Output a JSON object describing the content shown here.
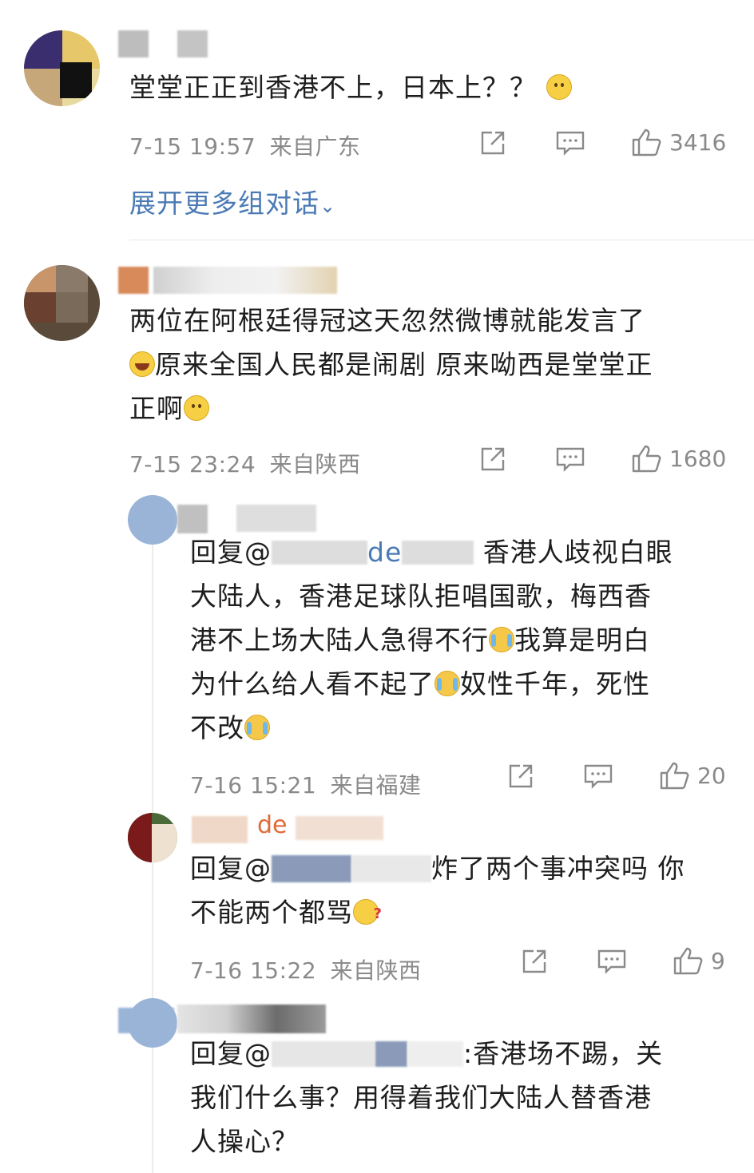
{
  "comments": [
    {
      "text": "堂堂正正到香港不上，日本上？？",
      "time": "7-15 19:57",
      "location": "来自广东",
      "likes": "3416",
      "expand": "展开更多组对话"
    },
    {
      "text_a": "两位在阿根廷得冠这天忽然微博就能发言了",
      "text_b": "原来全国人民都是闹剧 原来呦西是堂堂正",
      "text_c": "正啊",
      "time": "7-15 23:24",
      "location": "来自陕西",
      "likes": "1680"
    }
  ],
  "replies": [
    {
      "reply_prefix": "回复@",
      "mention_fragment": "de",
      "line1": "香港人歧视白眼",
      "line2": "大陆人，香港足球队拒唱国歌，梅西香",
      "line3": "港不上场大陆人急得不行",
      "line3b": "我算是明白",
      "line4": "为什么给人看不起了",
      "line4b": "奴性千年，死性",
      "line5": "不改",
      "time": "7-16 15:21",
      "location": "来自福建",
      "likes": "20"
    },
    {
      "name_fragment": "de",
      "reply_prefix": "回复@",
      "line1": "炸了两个事冲突吗 你",
      "line2": "不能两个都骂",
      "time": "7-16 15:22",
      "location": "来自陕西",
      "likes": "9"
    },
    {
      "reply_prefix": "回复@",
      "line1": ":香港场不踢，关",
      "line2": "我们什么事？用得着我们大陆人替香港",
      "line3": "人操心？"
    }
  ],
  "colors": {
    "link": "#4a7ab5",
    "meta": "#8a8a8a"
  },
  "icons": [
    "share-icon",
    "comment-icon",
    "like-icon",
    "chevron-down-icon"
  ]
}
